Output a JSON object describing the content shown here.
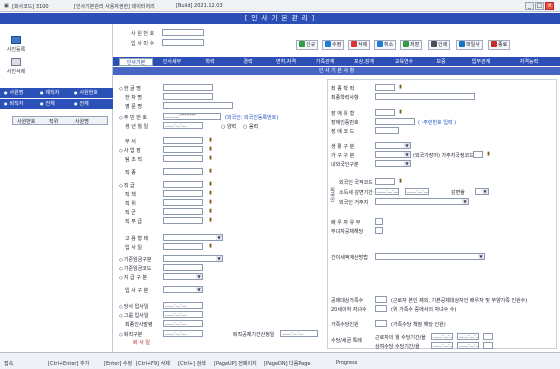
{
  "window": {
    "segments": [
      "[회사코드] 3100",
      "[인사기본관리 사용자권한] 데이터처리",
      "[Build] 2021.12.03"
    ],
    "controls": {
      "minimize": "_",
      "maximize": "□",
      "close": "×"
    }
  },
  "header": {
    "title": "[ 인 사 기 본 관 리 ]"
  },
  "sidebar": {
    "icons": [
      {
        "label": "사진등록",
        "icon": "photo-register-icon"
      },
      {
        "label": "사진삭제",
        "icon": "photo-delete-icon"
      }
    ],
    "filter_rows": [
      [
        "사원명",
        "재직자",
        "사원번호"
      ],
      [
        "퇴직자",
        "전체",
        "전체"
      ]
    ],
    "grid_headers": [
      "사원번호",
      "직위",
      "사원명"
    ]
  },
  "search": {
    "employee_no_label": "사 원 번 호",
    "hire_date_label": "입 사 미 수",
    "employee_no_value": "",
    "hire_date_value": ""
  },
  "toolbar": [
    {
      "label": "신규",
      "color": "#2f9e44"
    },
    {
      "label": "수정",
      "color": "#1c7ed6"
    },
    {
      "label": "삭제",
      "color": "#e03131"
    },
    {
      "label": "취소",
      "color": "#1c7ed6"
    },
    {
      "label": "저장",
      "color": "#2f9e44"
    },
    {
      "label": "인쇄",
      "color": "#495057"
    },
    {
      "label": "파일사",
      "color": "#1971c2"
    },
    {
      "label": "종료",
      "color": "#c92a2a"
    }
  ],
  "tabs": [
    "인사기본",
    "인사세부",
    "학력",
    "경력",
    "면허,자격",
    "가족관계",
    "포상,징계",
    "교육연수",
    "보증",
    "업무관계",
    "자격능력"
  ],
  "active_tab": 0,
  "section_title": "인 사 기 본 사 항",
  "left_form": {
    "name_labels": [
      "한 글 명",
      "한 자 명",
      "영 문 명"
    ],
    "resident_label": "주 민 번 호",
    "resident_value": "______-*******",
    "resident_note": "(외국인: 외국인등록번호)",
    "birth_label": "생 년 월 일",
    "birth_value": "____-__-__",
    "lunar_options": [
      "양력",
      "음력"
    ],
    "org_labels": [
      "부 서",
      "사 업 장",
      "팀 조 직",
      "직 종",
      "직 급",
      "직 책",
      "직 위",
      "직 군",
      "직 무 급"
    ],
    "employment_labels": [
      "고 용 형 태",
      "입 사 일"
    ],
    "grade_labels": [
      "기준임금구분",
      "기준임금코드",
      "지 급 구 분",
      "입 사 구 분"
    ],
    "date_labels": [
      "당사 입사일",
      "그룹 입사일",
      "최종인사발령",
      "퇴직구분"
    ],
    "retirement_label": "퇴 사 일",
    "retirement_note": "퇴직공제기간산정일",
    "date_placeholder": "____-__-__"
  },
  "right_form": {
    "edu_labels": [
      "최 종 학 력",
      "최종학력사항"
    ],
    "disability_labels": [
      "장 애 유 형",
      "장애인증번호",
      "장 애 코 드"
    ],
    "disability_note": "( -주민번호 입력 )",
    "veteran_labels": [
      "생 활 구 분",
      "가 구 구 분",
      "내외국인구분"
    ],
    "household_note": "(외국가장어) 가주지국정코드",
    "foreign_section_label": "외국인",
    "foreign_labels": [
      "외국인 국적코드",
      "소득세 감면기간",
      "외국인 거주지"
    ],
    "foreign_extra_label": "감면율",
    "spouse_labels": [
      "배 우 자 유 무",
      "부녀자공제해당"
    ],
    "tax_label": "간이세액계산방법",
    "deduction_labels": [
      "공제대상가족수",
      "20세이하 자녀수"
    ],
    "deduction_notes": [
      "(근로자 본인 제외, 기본공제대상자인 배우자 및 부양가족 인원수)",
      "(위 가족수 중에서의 자녀수 수)"
    ],
    "housing_label": "가족수당인원",
    "housing_note": "(가족수당 책정 해당 인원)",
    "meal_labels": [
      "근로자의 월 수당기간/을",
      "상여수당 수당기간/을"
    ],
    "meal_section_label": "수당/세금 특례",
    "date_placeholder": "____-__-__"
  },
  "statusbar": [
    "접속",
    "[Ctrl+Enter] 추가",
    "[Enter] 수정",
    "[Ctrl+F9] 삭제",
    "[Ctrl+] 검색",
    "[PageUP] 전페이지",
    "[PageDN] 다음Page",
    "Progress"
  ]
}
